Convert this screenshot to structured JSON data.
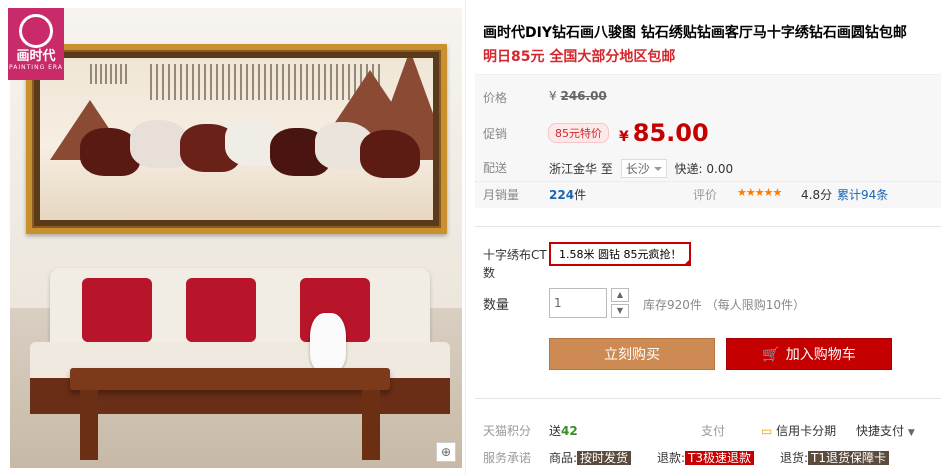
{
  "brand": {
    "line1": "画时代",
    "line2": "PAINTING ERA"
  },
  "product": {
    "title": "画时代DIY钻石画八骏图 钻石绣贴钻画客厅马十字绣钻石画圆钻包邮",
    "subtitle": "明日85元 全国大部分地区包邮"
  },
  "price": {
    "orig_label": "价格",
    "orig_currency": "¥",
    "orig_value": "246.00",
    "promo_label": "促销",
    "promo_tag": "85元特价",
    "currency": "¥",
    "value": "85.00"
  },
  "shipping": {
    "label": "配送",
    "from": "浙江金华",
    "to_word": "至",
    "city": "长沙",
    "fee": "快递: 0.00"
  },
  "sales": {
    "label": "月销量",
    "count": "224",
    "unit": "件",
    "rating_label": "评价",
    "stars": "★★★★★",
    "score": "4.8分",
    "reviews": "累计94条",
    "rating_value": 4.8
  },
  "options": {
    "label": "十字绣布CT数",
    "selected": "1.58米 圆钻 85元疯抢！"
  },
  "quantity": {
    "label": "数量",
    "value": "1",
    "stock": "库存920件 （每人限购10件）"
  },
  "buttons": {
    "buy": "立刻购买",
    "cart": "加入购物车"
  },
  "footer": {
    "points_label": "天猫积分",
    "points_prefix": "送",
    "points_value": "42",
    "pay_label": "支付",
    "credit": "信用卡分期",
    "quick": "快捷支付",
    "service_label": "服务承诺",
    "goods_label": "商品:",
    "goods_tag": "按时发货",
    "refund_label": "退款:",
    "refund_tag": "T3极速退款",
    "return_label": "退货:",
    "return_tag": "T1退货保障卡"
  },
  "colors": {
    "accent_red": "#c40000",
    "buy_button": "#cd8a52",
    "brand_pink": "#c82a6a"
  }
}
